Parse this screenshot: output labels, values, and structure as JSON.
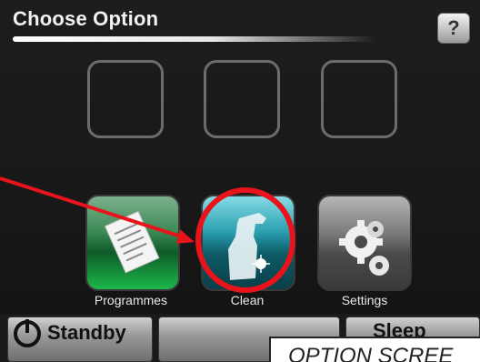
{
  "header": {
    "title": "Choose Option",
    "help_label": "?"
  },
  "empty_slots": [
    {
      "name": "empty-slot-1"
    },
    {
      "name": "empty-slot-2"
    },
    {
      "name": "empty-slot-3"
    }
  ],
  "tiles": [
    {
      "label": "Programmes",
      "icon": "document-icon",
      "color": "#1db84a"
    },
    {
      "label": "Clean",
      "icon": "spray-bottle-icon",
      "color": "#2aa0b0"
    },
    {
      "label": "Settings",
      "icon": "gears-icon",
      "color": "#7a7a7a"
    }
  ],
  "bottom_bar": {
    "standby_label": "Standby",
    "sleep_label": "Sleep"
  },
  "annotation": {
    "caption": "OPTION SCREE",
    "highlight_color": "#e8131b"
  }
}
